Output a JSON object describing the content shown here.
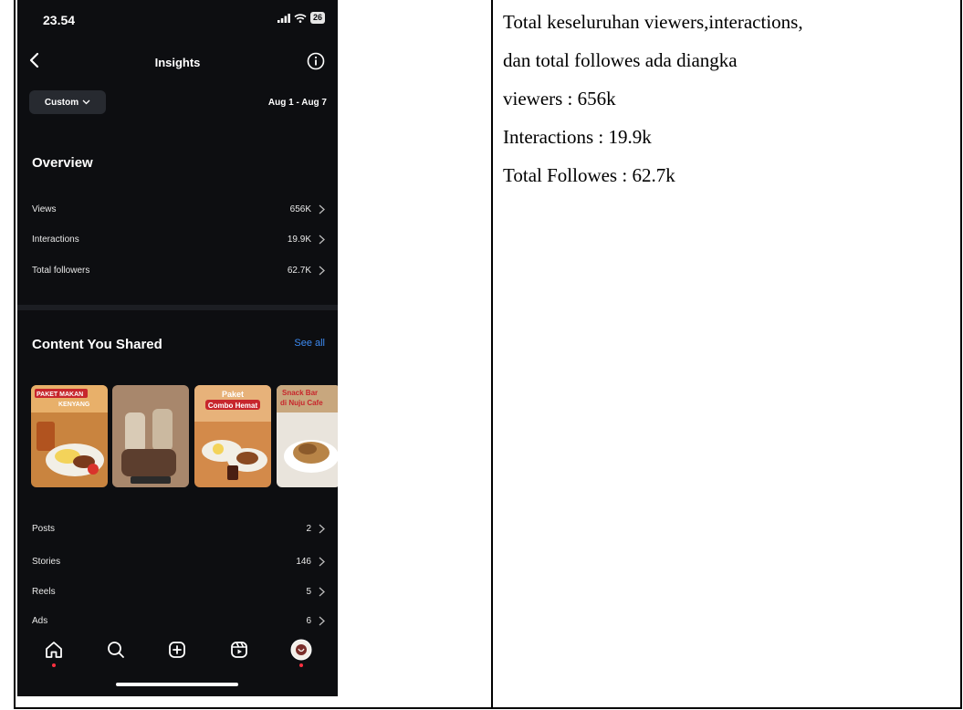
{
  "status_bar": {
    "time": "23.54",
    "battery": "26"
  },
  "header": {
    "title": "Insights"
  },
  "filter": {
    "selector_label": "Custom",
    "date_range": "Aug 1 - Aug 7"
  },
  "overview": {
    "title": "Overview",
    "rows": [
      {
        "label": "Views",
        "value": "656K"
      },
      {
        "label": "Interactions",
        "value": "19.9K"
      },
      {
        "label": "Total followers",
        "value": "62.7K"
      }
    ]
  },
  "content": {
    "title": "Content You Shared",
    "see_all": "See all",
    "thumbnails": [
      {
        "line1": "PAKET MAKAN",
        "line2": "KENYANG",
        "bg": "#c9843f"
      },
      {
        "line1": "",
        "line2": "",
        "bg": "#8a6a52"
      },
      {
        "line1": "Paket",
        "line2": "Combo Hemat",
        "bg": "#d38a4a"
      },
      {
        "line1": "Snack Bar",
        "line2": "di Nuju Cafe",
        "bg": "#e9e4dc"
      }
    ],
    "rows": [
      {
        "label": "Posts",
        "value": "2"
      },
      {
        "label": "Stories",
        "value": "146"
      },
      {
        "label": "Reels",
        "value": "5"
      },
      {
        "label": "Ads",
        "value": "6"
      }
    ]
  },
  "bottom_nav": [
    "home-icon",
    "search-icon",
    "create-icon",
    "reels-icon",
    "profile-avatar"
  ],
  "colors": {
    "background": "#0d0e11",
    "accent_blue": "#3d8bf2",
    "notification_red": "#ff3040"
  },
  "notes": {
    "line1": "Total keseluruhan viewers,interactions,",
    "line2": "dan total followes ada diangka",
    "line3": "viewers : 656k",
    "line4": "Interactions : 19.9k",
    "line5": "Total Followes : 62.7k"
  }
}
